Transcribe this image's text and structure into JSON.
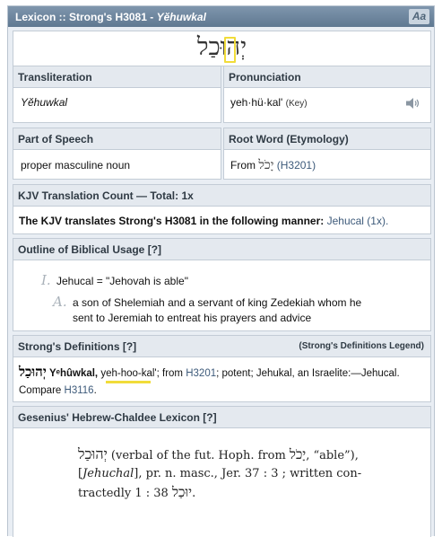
{
  "titlebar": {
    "prefix": "Lexicon :: Strong's H3081 - ",
    "word_italic": "Yĕhuwkal",
    "font_button": "Aa"
  },
  "headword": {
    "hebrew": "יְהוּכַל"
  },
  "transliteration": {
    "label": "Transliteration",
    "value": "Yĕhuwkal"
  },
  "pronunciation": {
    "label": "Pronunciation",
    "value": "yeh·hü·kal'",
    "key_link": "(Key)",
    "audio_icon": "speaker-icon"
  },
  "part_of_speech": {
    "label": "Part of Speech",
    "value": "proper masculine noun"
  },
  "root_word": {
    "label": "Root Word (Etymology)",
    "from": "From",
    "hebrew": "יָכֹל",
    "ref": "(H3201)"
  },
  "kjv_count": {
    "label": "KJV Translation Count — Total: 1x",
    "text_bold": "The KJV translates Strong's H3081 in the following manner:",
    "rendering": "Jehucal (1x)."
  },
  "outline": {
    "label": "Outline of Biblical Usage [?]",
    "numeral_1": "I.",
    "item_1": "Jehucal = \"Jehovah is able\"",
    "numeral_2": "A.",
    "item_2_line1": "a son of Shelemiah and a servant of king Zedekiah whom he",
    "item_2_line2": "sent to Jeremiah to entreat his prayers and advice"
  },
  "strongs": {
    "label": "Strong's Definitions [?]",
    "legend": "(Strong's Definitions Legend)",
    "hebrew": "יְהוּכַל",
    "translit": "Yᵉhûwkal,",
    "pron": "yeh-hoo-kal'",
    "text1": "; from",
    "ref1": "H3201",
    "text2": "; potent; Jehukal, an Israelite:—Jehucal.",
    "text3": "Compare",
    "ref2": "H3116",
    "text4": "."
  },
  "gesenius": {
    "label": "Gesenius' Hebrew-Chaldee Lexicon [?]",
    "line1_heb": "יְהוּכַל",
    "line1_a": " (verbal of the fut. Hoph. from ",
    "line1_heb2": "יָכֹל",
    "line1_b": ", “able”),",
    "line2_a": "[",
    "line2_ital": "Jehuchal",
    "line2_b": "], pr. n. masc., Jer. 37 : 3 ; written con-",
    "line3_a": "tractedly ",
    "line3_heb": "יוּכַל",
    "line3_b": " 38 : 1."
  }
}
